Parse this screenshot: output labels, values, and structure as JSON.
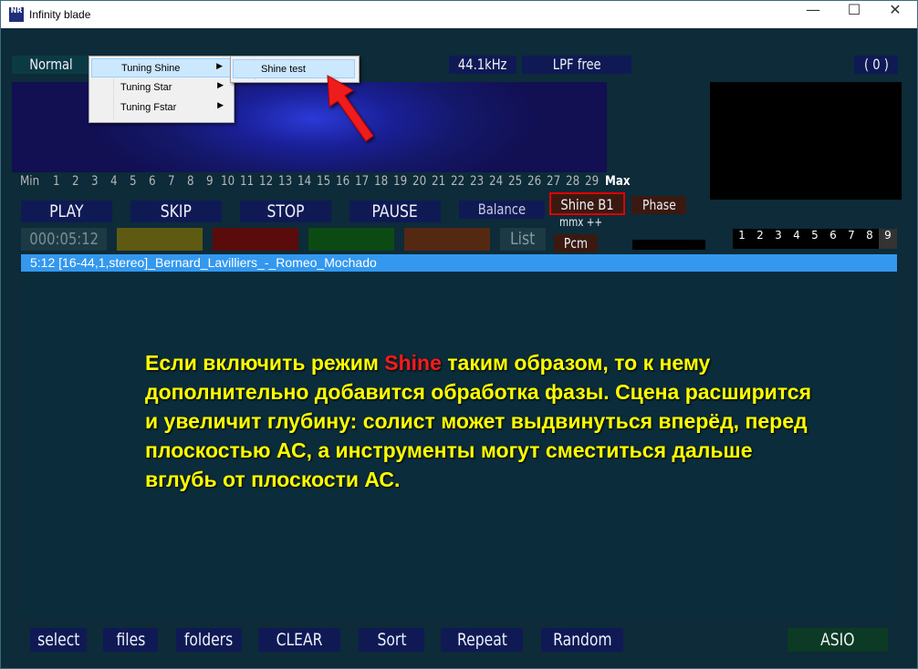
{
  "window": {
    "title": "Infinity blade",
    "icon_text": "NR",
    "controls": [
      "—",
      "☐",
      "✕"
    ]
  },
  "top": {
    "mode": "Normal",
    "sample_rate": "44.1kHz",
    "filter": "LPF free",
    "counter": "( 0 )"
  },
  "menu": {
    "items": [
      {
        "label": "Tuning Shine",
        "arrow": "▶"
      },
      {
        "label": "Tuning Star",
        "arrow": "▶"
      },
      {
        "label": "Tuning Fstar",
        "arrow": "▶"
      }
    ],
    "submenu_item": "Shine test"
  },
  "scale": {
    "min": "Min",
    "numbers": [
      "1",
      "2",
      "3",
      "4",
      "5",
      "6",
      "7",
      "8",
      "9",
      "10",
      "11",
      "12",
      "13",
      "14",
      "15",
      "16",
      "17",
      "18",
      "19",
      "20",
      "21",
      "22",
      "23",
      "24",
      "25",
      "26",
      "27",
      "28",
      "29"
    ],
    "max": "Max"
  },
  "transport": {
    "play": "PLAY",
    "skip": "SKIP",
    "stop": "STOP",
    "pause": "PAUSE",
    "balance": "Balance",
    "shine": "Shine B1",
    "phase": "Phase",
    "mmx": "mmx ++",
    "pcm": "Pcm",
    "time": "000:05:12",
    "list": "List"
  },
  "presets": [
    "1",
    "2",
    "3",
    "4",
    "5",
    "6",
    "7",
    "8",
    "9"
  ],
  "track": "5:12  [16-44,1,stereo]_Bernard_Lavilliers_-_Romeo_Mochado",
  "overlay": {
    "pre": "Если включить режим ",
    "highlight": "Shine",
    "post": " таким образом, то к нему дополнительно добавится обработка фазы. Сцена расширится и увеличит глубину: солист может выдвинуться вперёд, перед плоскостью АС, а инструменты могут сместиться дальше вглубь от плоскости АС."
  },
  "bottom": {
    "select": "select",
    "files": "files",
    "folders": "folders",
    "clear": "CLEAR",
    "sort": "Sort",
    "repeat": "Repeat",
    "random": "Random",
    "asio": "ASIO"
  },
  "colors": {
    "accent": "#3398ee",
    "highlight_red": "#e00000",
    "overlay_text": "#ffff00"
  }
}
